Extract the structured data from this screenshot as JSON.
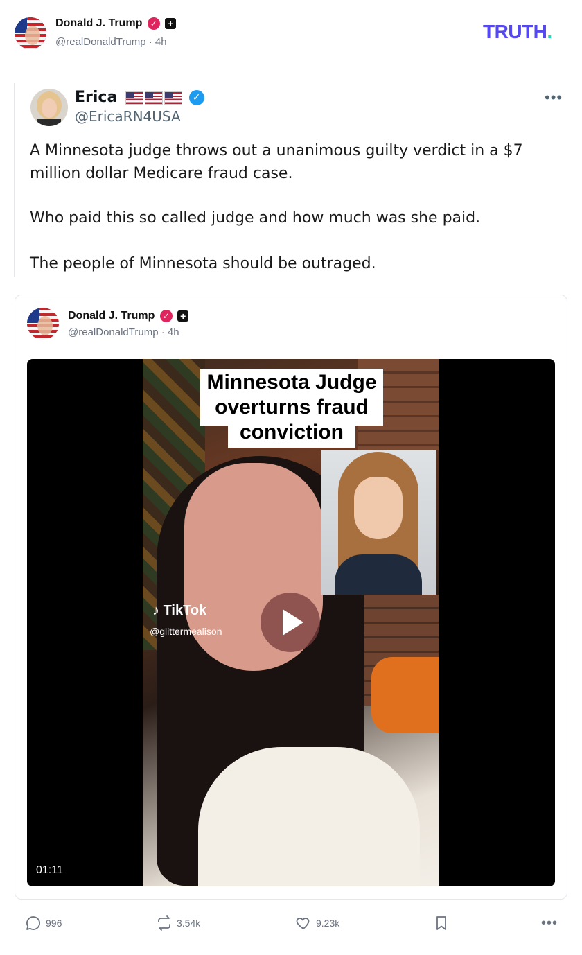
{
  "header": {
    "author_name": "Donald J. Trump",
    "author_handle": "@realDonaldTrump",
    "time_sep": "·",
    "time": "4h",
    "logo_text": "TRUTH",
    "logo_dot": "."
  },
  "quoted_tweet": {
    "name": "Erica",
    "handle": "@EricaRN4USA",
    "flags": [
      "us-flag",
      "us-flag",
      "us-flag"
    ],
    "menu_icon": "more-icon",
    "paragraphs": [
      "A Minnesota judge throws out a unanimous guilty verdict in a $7 million dollar Medicare fraud case.",
      "Who paid this so called judge and how much was she paid.",
      "The people of Minnesota should be outraged."
    ]
  },
  "embedded_post": {
    "author_name": "Donald J. Trump",
    "author_handle": "@realDonaldTrump",
    "time_sep": "·",
    "time": "4h",
    "video": {
      "caption_line1": "Minnesota Judge",
      "caption_line2": "overturns fraud",
      "caption_line3": "conviction",
      "watermark_brand": "TikTok",
      "watermark_handle": "@glittermealison",
      "duration": "01:11"
    }
  },
  "actions": {
    "replies": "996",
    "retruths": "3.54k",
    "likes": "9.23k"
  },
  "colors": {
    "brand": "#5448ee",
    "brand_dot": "#2ed3b7",
    "verified_pink": "#e0245e",
    "verified_blue": "#1d9bf0",
    "muted": "#6b7280"
  }
}
